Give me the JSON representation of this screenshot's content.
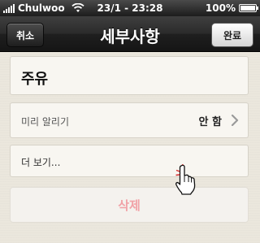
{
  "status_bar": {
    "carrier": "Chulwoo",
    "datetime": "23/1 - 23:28",
    "battery": "100%",
    "battery_level": 1.0
  },
  "nav": {
    "title": "세부사항",
    "cancel_label": "취소",
    "done_label": "완료"
  },
  "detail": {
    "item_title": "주유",
    "reminder_label": "미리 알리기",
    "reminder_value": "안 함",
    "more_label": "더 보기...",
    "delete_label": "삭제"
  },
  "icons": {
    "signal": "signal-icon",
    "wifi": "wifi-icon",
    "battery": "battery-icon",
    "chevron": "chevron-right-icon",
    "cursor": "hand-pointer-icon"
  },
  "colors": {
    "delete_text": "#f1a2a7",
    "background": "#ebe7dd"
  }
}
